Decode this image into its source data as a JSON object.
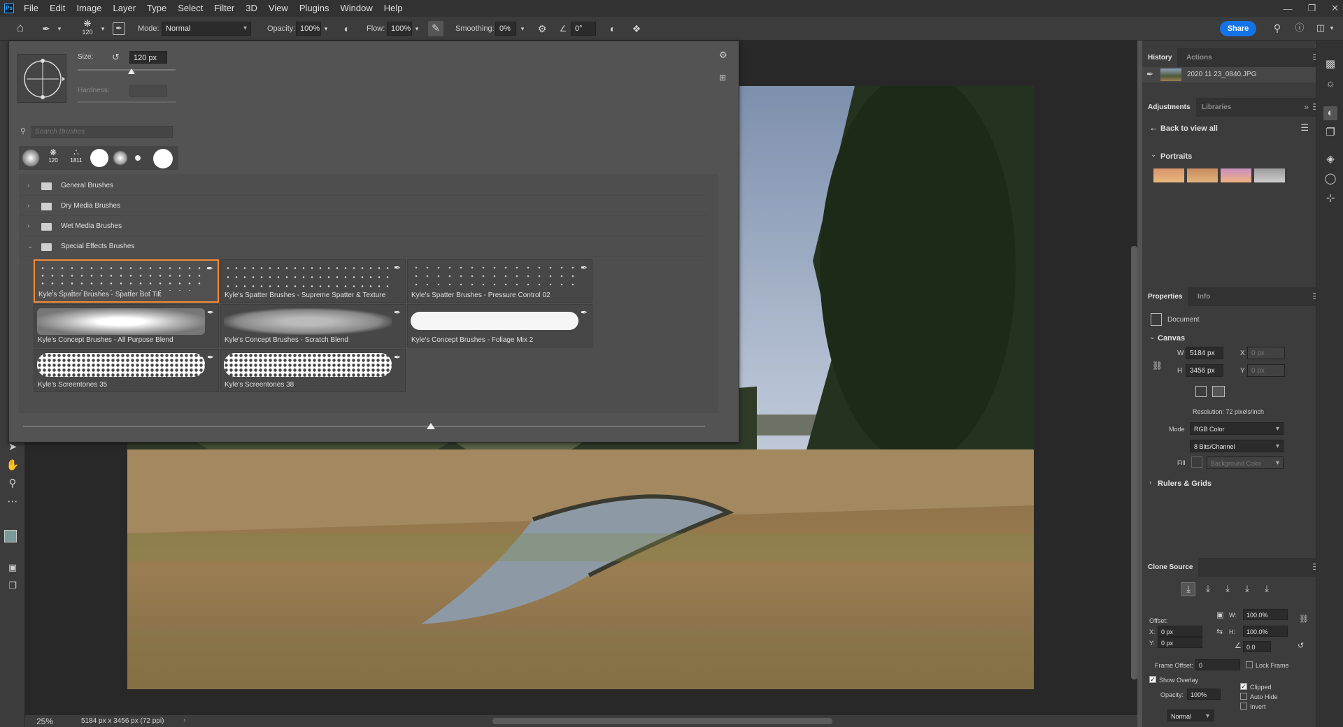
{
  "menubar": {
    "logo": "Ps",
    "items": [
      "File",
      "Edit",
      "Image",
      "Layer",
      "Type",
      "Select",
      "Filter",
      "3D",
      "View",
      "Plugins",
      "Window",
      "Help"
    ]
  },
  "options": {
    "brush_size_preview": "120",
    "mode_label": "Mode:",
    "mode_value": "Normal",
    "opacity_label": "Opacity:",
    "opacity_value": "100%",
    "flow_label": "Flow:",
    "flow_value": "100%",
    "smoothing_label": "Smoothing:",
    "smoothing_value": "0%",
    "angle_value": "0°",
    "share_label": "Share"
  },
  "brush_picker": {
    "size_label": "Size:",
    "size_value": "120 px",
    "size_fraction": 0.55,
    "hardness_label": "Hardness:",
    "search_placeholder": "Search Brushes",
    "recent_labels": [
      "",
      "120",
      "1811",
      "",
      "",
      "",
      ""
    ],
    "folders": [
      "General Brushes",
      "Dry Media Brushes",
      "Wet Media Brushes",
      "Special Effects Brushes"
    ],
    "brushes": [
      {
        "name": "Kyle's Spatter Brushes - Spatter Bot Tilt",
        "selected": true
      },
      {
        "name": "Kyle's Spatter Brushes - Supreme Spatter & Texture"
      },
      {
        "name": "Kyle's Spatter Brushes - Pressure Control 02"
      },
      {
        "name": "Kyle's Concept Brushes - All Purpose Blend"
      },
      {
        "name": "Kyle's Concept Brushes - Scratch Blend"
      },
      {
        "name": "Kyle's Concept Brushes - Foliage Mix 2"
      },
      {
        "name": "Kyle's Screentones 35"
      },
      {
        "name": "Kyle's Screentones 38"
      }
    ]
  },
  "status": {
    "zoom": "25%",
    "doc_info": "5184 px x 3456 px (72 ppi)"
  },
  "history": {
    "tabs": [
      "History",
      "Actions"
    ],
    "snapshot_name": "2020 11 23_0840.JPG"
  },
  "adjustments": {
    "tabs": [
      "Adjustments",
      "Libraries"
    ],
    "back_label": "Back to view all",
    "group_label": "Portraits"
  },
  "properties": {
    "tabs": [
      "Properties",
      "Info"
    ],
    "doc_label": "Document",
    "canvas_label": "Canvas",
    "w_label": "W",
    "w_value": "5184 px",
    "h_label": "H",
    "h_value": "3456 px",
    "x_label": "X",
    "x_placeholder": "0 px",
    "y_label": "Y",
    "y_placeholder": "0 px",
    "resolution": "Resolution: 72 pixels/inch",
    "mode_label": "Mode",
    "mode_value": "RGB Color",
    "depth_value": "8 Bits/Channel",
    "fill_label": "Fill",
    "fill_value": "Background Color",
    "rulers_label": "Rulers & Grids"
  },
  "clone_source": {
    "title": "Clone Source",
    "offset_label": "Offset:",
    "x_label": "X:",
    "x_value": "0 px",
    "y_label": "Y:",
    "y_value": "0 px",
    "w_label": "W:",
    "w_value": "100.0%",
    "h_label": "H:",
    "h_value": "100.0%",
    "angle_value": "0.0",
    "frame_offset_label": "Frame Offset:",
    "frame_offset_value": "0",
    "lock_frame_label": "Lock Frame",
    "show_overlay_label": "Show Overlay",
    "opacity_label": "Opacity:",
    "opacity_value": "100%",
    "clipped_label": "Clipped",
    "auto_hide_label": "Auto Hide",
    "invert_label": "Invert",
    "blend_value": "Normal"
  },
  "colors": {
    "accent": "#1473e6",
    "selection": "#f28a35"
  }
}
